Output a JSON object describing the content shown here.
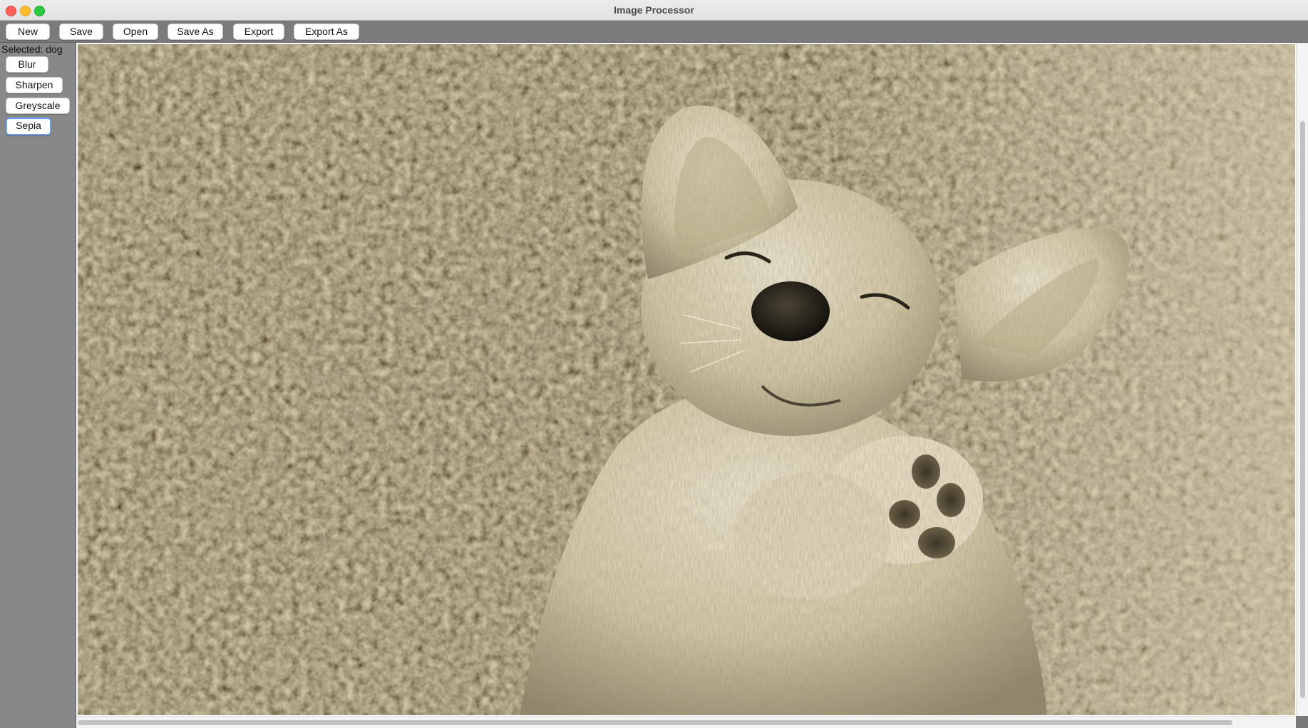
{
  "window": {
    "title": "Image Processor"
  },
  "toolbar": {
    "buttons": [
      {
        "label": "New"
      },
      {
        "label": "Save"
      },
      {
        "label": "Open"
      },
      {
        "label": "Save As"
      },
      {
        "label": "Export"
      },
      {
        "label": "Export As"
      }
    ]
  },
  "sidebar": {
    "selected_label": "Selected: dog",
    "filters": [
      {
        "label": "Blur"
      },
      {
        "label": "Sharpen"
      },
      {
        "label": "Greyscale"
      },
      {
        "label": "Sepia",
        "active": true
      }
    ]
  },
  "canvas": {
    "image_subject": "sepia-toned photo of a puppy lying on its back on a shaggy carpet",
    "filter_applied": "Sepia"
  },
  "colors": {
    "titlebar": "#e6e6e6",
    "toolbar_bg": "#7b7b7b",
    "sidebar_bg": "#888888",
    "active_focus": "#6aa0f0",
    "traffic_close": "#fe5f57",
    "traffic_min": "#febc2e",
    "traffic_max": "#28c840"
  }
}
